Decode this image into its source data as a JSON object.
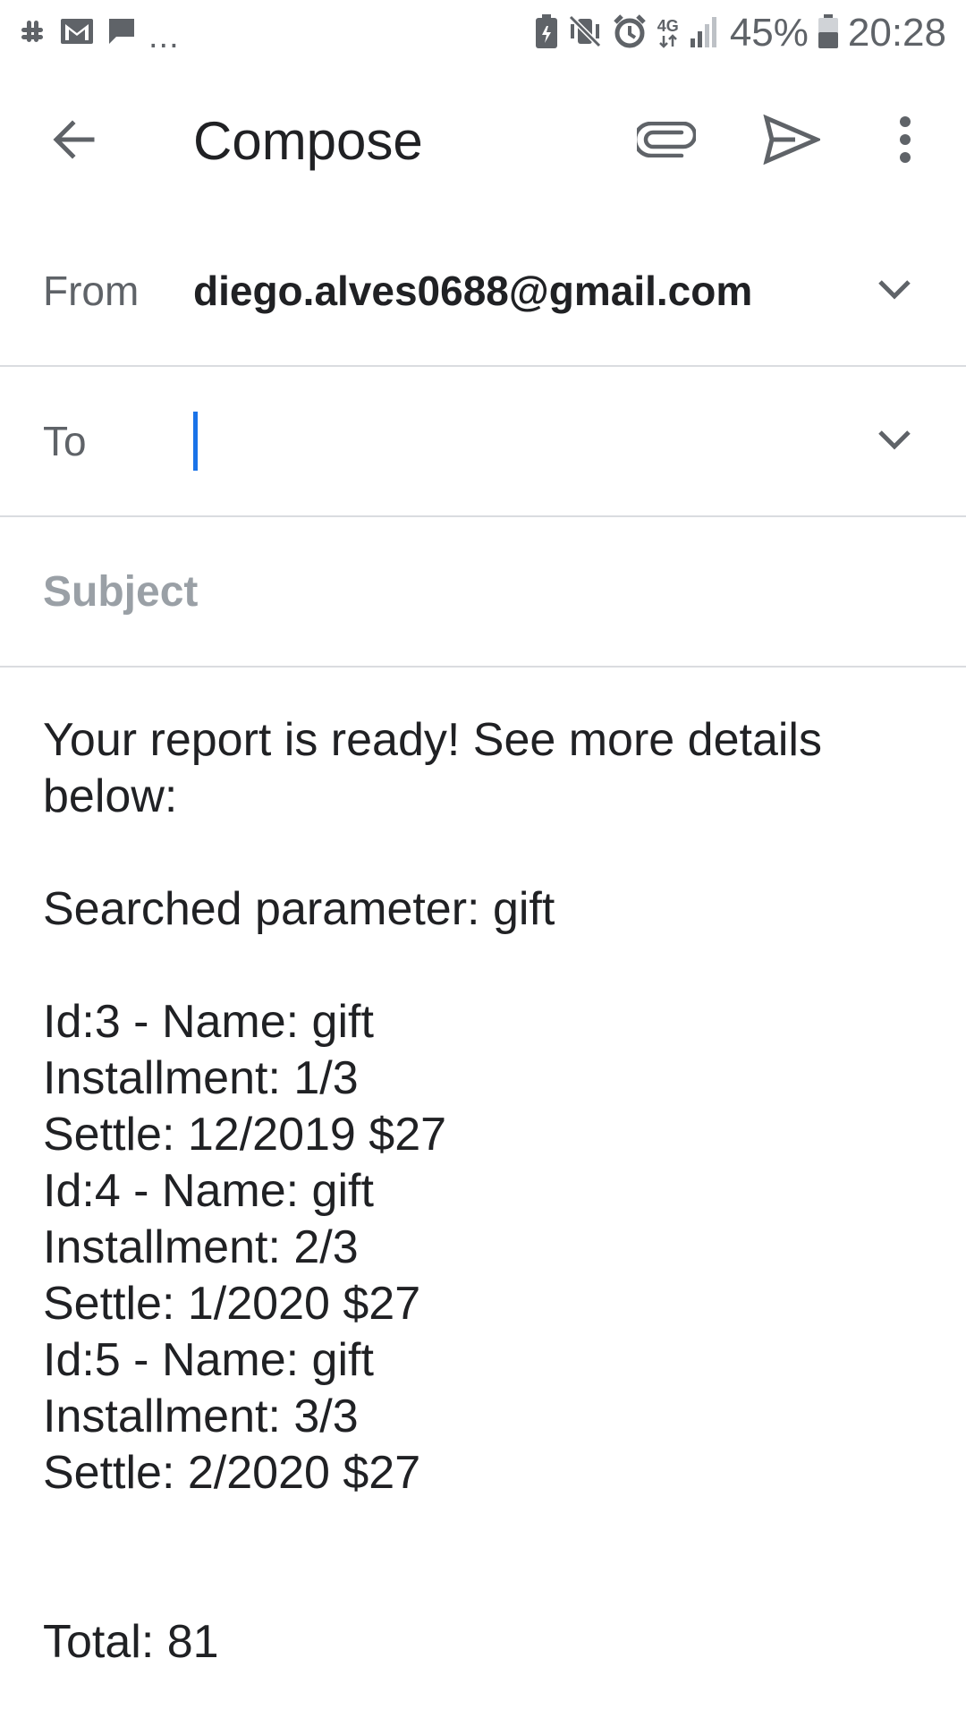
{
  "status_bar": {
    "left_icons": [
      "slack-icon",
      "gmail-icon",
      "chat-bubble-icon"
    ],
    "overflow": "...",
    "right_icons": [
      "battery-saver-icon",
      "vibrate-icon",
      "alarm-icon",
      "network-icon",
      "signal-icon",
      "battery-icon"
    ],
    "network": "4G",
    "battery": "45%",
    "time": "20:28"
  },
  "app_bar": {
    "title": "Compose",
    "icons": [
      "back-arrow-icon",
      "paperclip-icon",
      "send-icon",
      "more-vert-icon"
    ]
  },
  "from_field": {
    "label": "From",
    "value": "diego.alves0688@gmail.com"
  },
  "to_field": {
    "label": "To",
    "value": ""
  },
  "subject_field": {
    "placeholder": "Subject",
    "value": ""
  },
  "body": {
    "lines": [
      "Your report is ready! See more details",
      "below:",
      "",
      "Searched parameter: gift",
      "",
      "Id:3 - Name: gift",
      "Installment: 1/3",
      "Settle: 12/2019 $27",
      "Id:4 - Name: gift",
      "Installment: 2/3",
      "Settle: 1/2020 $27",
      "Id:5 - Name: gift",
      "Installment: 3/3",
      "Settle: 2/2020 $27",
      "",
      "",
      "Total: 81"
    ]
  },
  "colors": {
    "caret": "#1a73e8",
    "icon": "#5f6368",
    "divider": "#dadce0"
  }
}
